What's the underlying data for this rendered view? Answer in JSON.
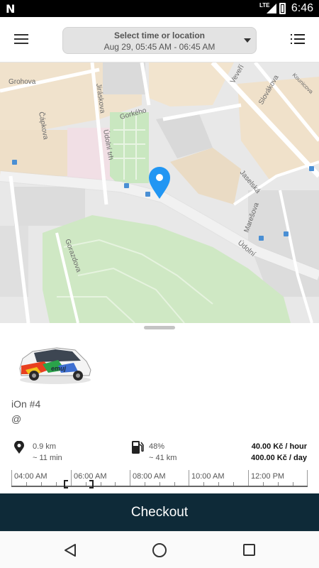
{
  "status_bar": {
    "logo": "N",
    "network": "LTE",
    "time": "6:46"
  },
  "app_bar": {
    "menu_icon": "hamburger-menu-icon",
    "selector_title": "Select time or location",
    "selector_value": "Aug 29, 05:45 AM - 06:45 AM",
    "list_icon": "list-view-icon"
  },
  "map": {
    "streets": [
      "Grohova",
      "Čápkova",
      "Jiráskova",
      "Gorkého",
      "Údolní trh",
      "Veveří",
      "Slovákova",
      "Kounicova",
      "Jaselská",
      "Marešova",
      "Údolní",
      "Gorazdova"
    ],
    "marker_icon": "location-pin-icon"
  },
  "car": {
    "image": "car-photo",
    "name": "iOn #4",
    "address": "@",
    "distance": "0.9 km",
    "walk_time": "~ 11 min",
    "fuel": "48%",
    "range": "~ 41 km",
    "price_hour": "40.00 Kč / hour",
    "price_day": "400.00 Kč / day"
  },
  "timeline": {
    "labels": [
      "04:00 AM",
      "06:00 AM",
      "08:00 AM",
      "10:00 AM",
      "12:00 PM"
    ]
  },
  "checkout": {
    "label": "Checkout"
  },
  "nav": {
    "back_icon": "back-triangle-icon",
    "home_icon": "home-circle-icon",
    "recent_icon": "recent-apps-icon"
  },
  "colors": {
    "checkout_bg": "#0e2a38",
    "marker": "#2196f3",
    "park": "#cfe8c4"
  }
}
